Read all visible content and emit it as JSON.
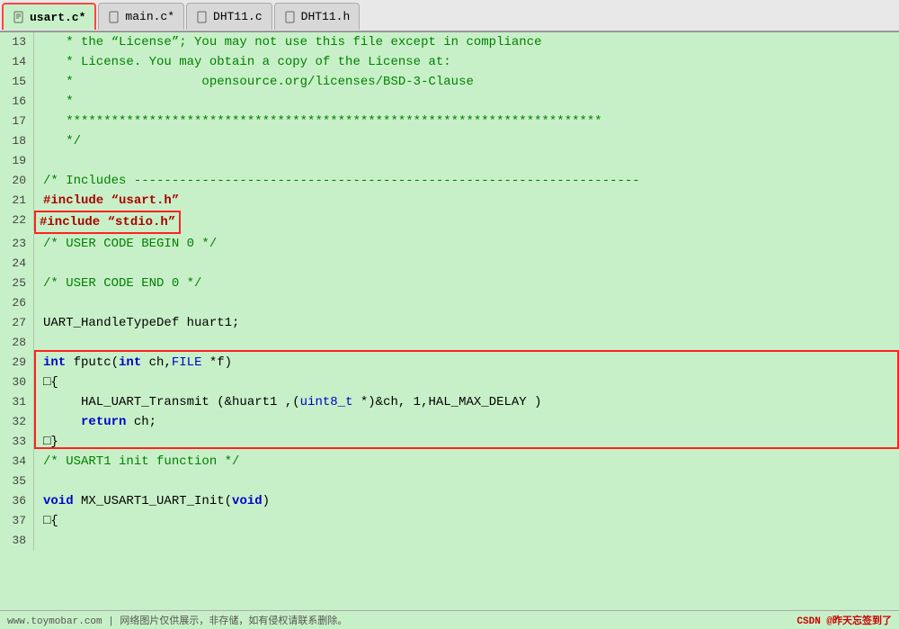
{
  "tabs": [
    {
      "id": "usart-c",
      "label": "usart.c*",
      "active": true
    },
    {
      "id": "main-c",
      "label": "main.c*",
      "active": false
    },
    {
      "id": "dht11-c",
      "label": "DHT11.c",
      "active": false
    },
    {
      "id": "dht11-h",
      "label": "DHT11.h",
      "active": false
    }
  ],
  "lines": [
    {
      "num": "13",
      "content": "   * the “License”; You may not use this file except in compliance"
    },
    {
      "num": "14",
      "content": "   * License. You may obtain a copy of the License at:"
    },
    {
      "num": "15",
      "content": "   *                 opensource.org/licenses/BSD-3-Clause"
    },
    {
      "num": "16",
      "content": "   *"
    },
    {
      "num": "17",
      "content": "   ***********************************************************************"
    },
    {
      "num": "18",
      "content": "   */"
    },
    {
      "num": "19",
      "content": ""
    },
    {
      "num": "20",
      "content": "/* Includes -------------------------------------------------------------------"
    },
    {
      "num": "21",
      "content": "#include “usart.h”"
    },
    {
      "num": "22",
      "content": "#include “stdio.h”",
      "highlighted": true
    },
    {
      "num": "23",
      "content": "/* USER CODE BEGIN 0 */"
    },
    {
      "num": "24",
      "content": ""
    },
    {
      "num": "25",
      "content": "/* USER CODE END 0 */"
    },
    {
      "num": "26",
      "content": ""
    },
    {
      "num": "27",
      "content": "UART_HandleTypeDef huart1;"
    },
    {
      "num": "28",
      "content": ""
    },
    {
      "num": "29",
      "content": "int fputc(int ch,FILE *f)",
      "funcStart": true
    },
    {
      "num": "30",
      "content": "□{",
      "funcLine": true
    },
    {
      "num": "31",
      "content": "     HAL_UART_Transmit (&huart1 ,(uint8_t *)&ch, 1,HAL_MAX_DELAY )",
      "funcLine": true
    },
    {
      "num": "32",
      "content": "     return ch;",
      "funcLine": true
    },
    {
      "num": "33",
      "content": "□}",
      "funcEnd": true
    },
    {
      "num": "34",
      "content": "/* USART1 init function */"
    },
    {
      "num": "35",
      "content": ""
    },
    {
      "num": "36",
      "content": "void MX_USART1_UART_Init(void)"
    },
    {
      "num": "37",
      "content": "□{"
    },
    {
      "num": "38",
      "content": ""
    }
  ],
  "footer": {
    "left": "www.toymobar.com | 网络图片仅供展示，非存储，如有侵权请联系删除。",
    "right": "CSDN @昨天忘签到了"
  }
}
